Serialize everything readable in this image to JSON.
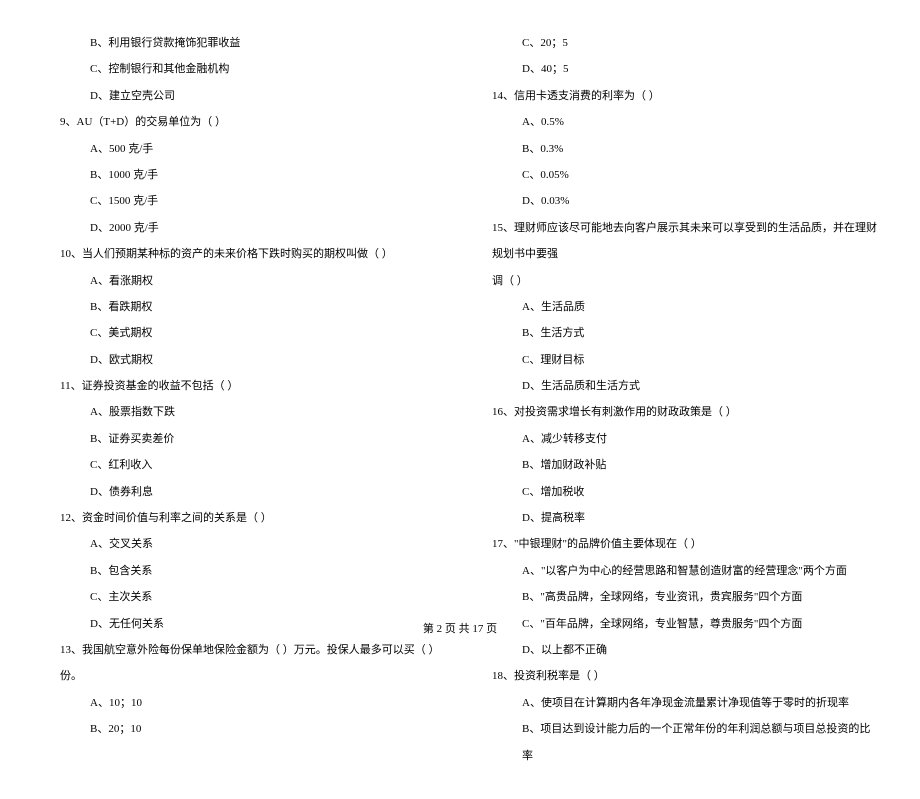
{
  "left": {
    "opt_b": "B、利用银行贷款掩饰犯罪收益",
    "opt_c": "C、控制银行和其他金融机构",
    "opt_d": "D、建立空壳公司",
    "q9": "9、AU（T+D）的交易单位为（    ）",
    "q9a": "A、500 克/手",
    "q9b": "B、1000 克/手",
    "q9c": "C、1500 克/手",
    "q9d": "D、2000 克/手",
    "q10": "10、当人们预期某种标的资产的未来价格下跌时购买的期权叫做（    ）",
    "q10a": "A、看涨期权",
    "q10b": "B、看跌期权",
    "q10c": "C、美式期权",
    "q10d": "D、欧式期权",
    "q11": "11、证券投资基金的收益不包括（    ）",
    "q11a": "A、股票指数下跌",
    "q11b": "B、证券买卖差价",
    "q11c": "C、红利收入",
    "q11d": "D、债券利息",
    "q12": "12、资金时间价值与利率之间的关系是（    ）",
    "q12a": "A、交叉关系",
    "q12b": "B、包含关系",
    "q12c": "C、主次关系",
    "q12d": "D、无任何关系",
    "q13": "13、我国航空意外险每份保单地保险金额为（    ）万元。投保人最多可以买（    ）份。",
    "q13a": "A、10；10",
    "q13b": "B、20；10"
  },
  "right": {
    "q13c": "C、20；5",
    "q13d": "D、40；5",
    "q14": "14、信用卡透支消费的利率为（    ）",
    "q14a": "A、0.5%",
    "q14b": "B、0.3%",
    "q14c": "C、0.05%",
    "q14d": "D、0.03%",
    "q15": "15、理财师应该尽可能地去向客户展示其未来可以享受到的生活品质，并在理财规划书中要强",
    "q15_tail": "调（    ）",
    "q15a": "A、生活品质",
    "q15b": "B、生活方式",
    "q15c": "C、理财目标",
    "q15d": "D、生活品质和生活方式",
    "q16": "16、对投资需求增长有刺激作用的财政政策是（    ）",
    "q16a": "A、减少转移支付",
    "q16b": "B、增加财政补贴",
    "q16c": "C、增加税收",
    "q16d": "D、提高税率",
    "q17": "17、\"中银理财\"的品牌价值主要体现在（    ）",
    "q17a": "A、\"以客户为中心的经营思路和智慧创造财富的经营理念\"两个方面",
    "q17b": "B、\"高贵品牌，全球网络，专业资讯，贵宾服务\"四个方面",
    "q17c": "C、\"百年品牌，全球网络，专业智慧，尊贵服务\"四个方面",
    "q17d": "D、以上都不正确",
    "q18": "18、投资利税率是（    ）",
    "q18a": "A、使项目在计算期内各年净现金流量累计净现值等于零时的折现率",
    "q18b": "B、项目达到设计能力后的一个正常年份的年利润总额与项目总投资的比率"
  },
  "footer": "第 2 页 共 17 页"
}
